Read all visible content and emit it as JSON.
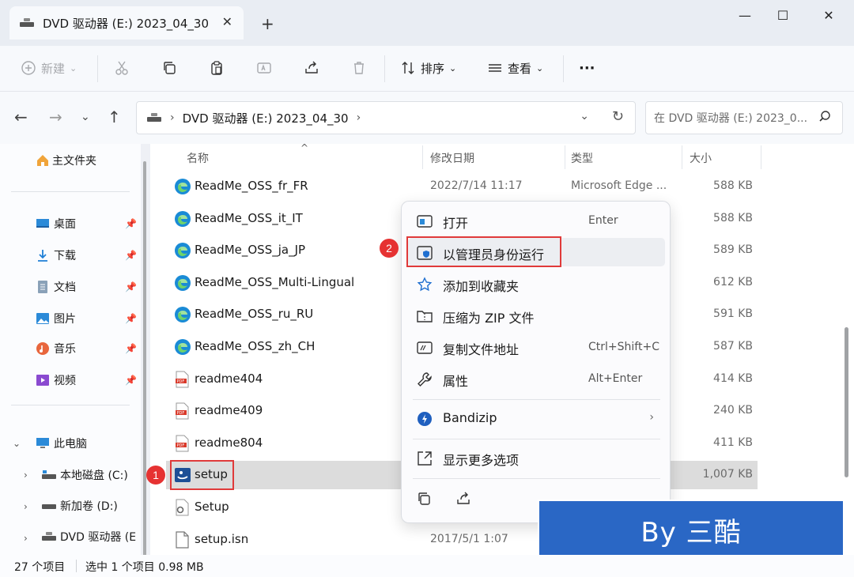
{
  "window": {
    "tab_title": "DVD 驱动器 (E:) 2023_04_30",
    "tab_close": "✕",
    "new_tab": "+",
    "minimize": "—",
    "maximize": "☐",
    "close": "✕"
  },
  "toolbar": {
    "new_label": "新建",
    "sort_label": "排序",
    "view_label": "查看",
    "more_label": "···"
  },
  "address": {
    "path": "DVD 驱动器 (E:) 2023_04_30",
    "search_placeholder": "在 DVD 驱动器 (E:) 2023_0..."
  },
  "sidebar": {
    "home": "主文件夹",
    "quick": [
      {
        "label": "桌面"
      },
      {
        "label": "下载"
      },
      {
        "label": "文档"
      },
      {
        "label": "图片"
      },
      {
        "label": "音乐"
      },
      {
        "label": "视频"
      }
    ],
    "this_pc": "此电脑",
    "drives": [
      {
        "label": "本地磁盘 (C:)"
      },
      {
        "label": "新加卷 (D:)"
      },
      {
        "label": "DVD 驱动器 (E"
      }
    ]
  },
  "columns": {
    "name": "名称",
    "date": "修改日期",
    "type": "类型",
    "size": "大小"
  },
  "files": [
    {
      "name": "ReadMe_OSS_fr_FR",
      "date": "2022/7/14 11:17",
      "type": "Microsoft Edge ...",
      "size": "588 KB",
      "icon": "edge"
    },
    {
      "name": "ReadMe_OSS_it_IT",
      "date": "",
      "type": "",
      "size": "588 KB",
      "icon": "edge"
    },
    {
      "name": "ReadMe_OSS_ja_JP",
      "date": "",
      "type": "",
      "size": "589 KB",
      "icon": "edge"
    },
    {
      "name": "ReadMe_OSS_Multi-Lingual",
      "date": "",
      "type": "",
      "size": "612 KB",
      "icon": "edge"
    },
    {
      "name": "ReadMe_OSS_ru_RU",
      "date": "",
      "type": "",
      "size": "591 KB",
      "icon": "edge"
    },
    {
      "name": "ReadMe_OSS_zh_CH",
      "date": "",
      "type": "",
      "size": "587 KB",
      "icon": "edge"
    },
    {
      "name": "readme404",
      "date": "",
      "type": "",
      "size": "414 KB",
      "icon": "pdf"
    },
    {
      "name": "readme409",
      "date": "",
      "type": "",
      "size": "240 KB",
      "icon": "pdf"
    },
    {
      "name": "readme804",
      "date": "",
      "type": "",
      "size": "411 KB",
      "icon": "pdf"
    },
    {
      "name": "setup",
      "date": "",
      "type": "",
      "size": "1,007 KB",
      "icon": "setup"
    },
    {
      "name": "Setup",
      "date": "",
      "type": "",
      "size": "",
      "icon": "gear"
    },
    {
      "name": "setup.isn",
      "date": "2017/5/1 1:07",
      "type": "",
      "size": "",
      "icon": "file"
    }
  ],
  "context_menu": {
    "open": {
      "label": "打开",
      "key": "Enter"
    },
    "run_admin": {
      "label": "以管理员身份运行"
    },
    "favorite": {
      "label": "添加到收藏夹"
    },
    "zip": {
      "label": "压缩为 ZIP 文件"
    },
    "copy_path": {
      "label": "复制文件地址",
      "key": "Ctrl+Shift+C"
    },
    "properties": {
      "label": "属性",
      "key": "Alt+Enter"
    },
    "bandizip": {
      "label": "Bandizip"
    },
    "more_options": {
      "label": "显示更多选项"
    }
  },
  "annotations": {
    "badge1": "1",
    "badge2": "2",
    "color": "#e03a3a"
  },
  "watermark": "By 三酷",
  "status": {
    "count": "27 个项目",
    "selected": "选中 1 个项目  0.98 MB"
  },
  "colors": {
    "accent": "#0067c0",
    "selection": "#dcdcdc",
    "watermark_bg": "#2a67c5"
  }
}
